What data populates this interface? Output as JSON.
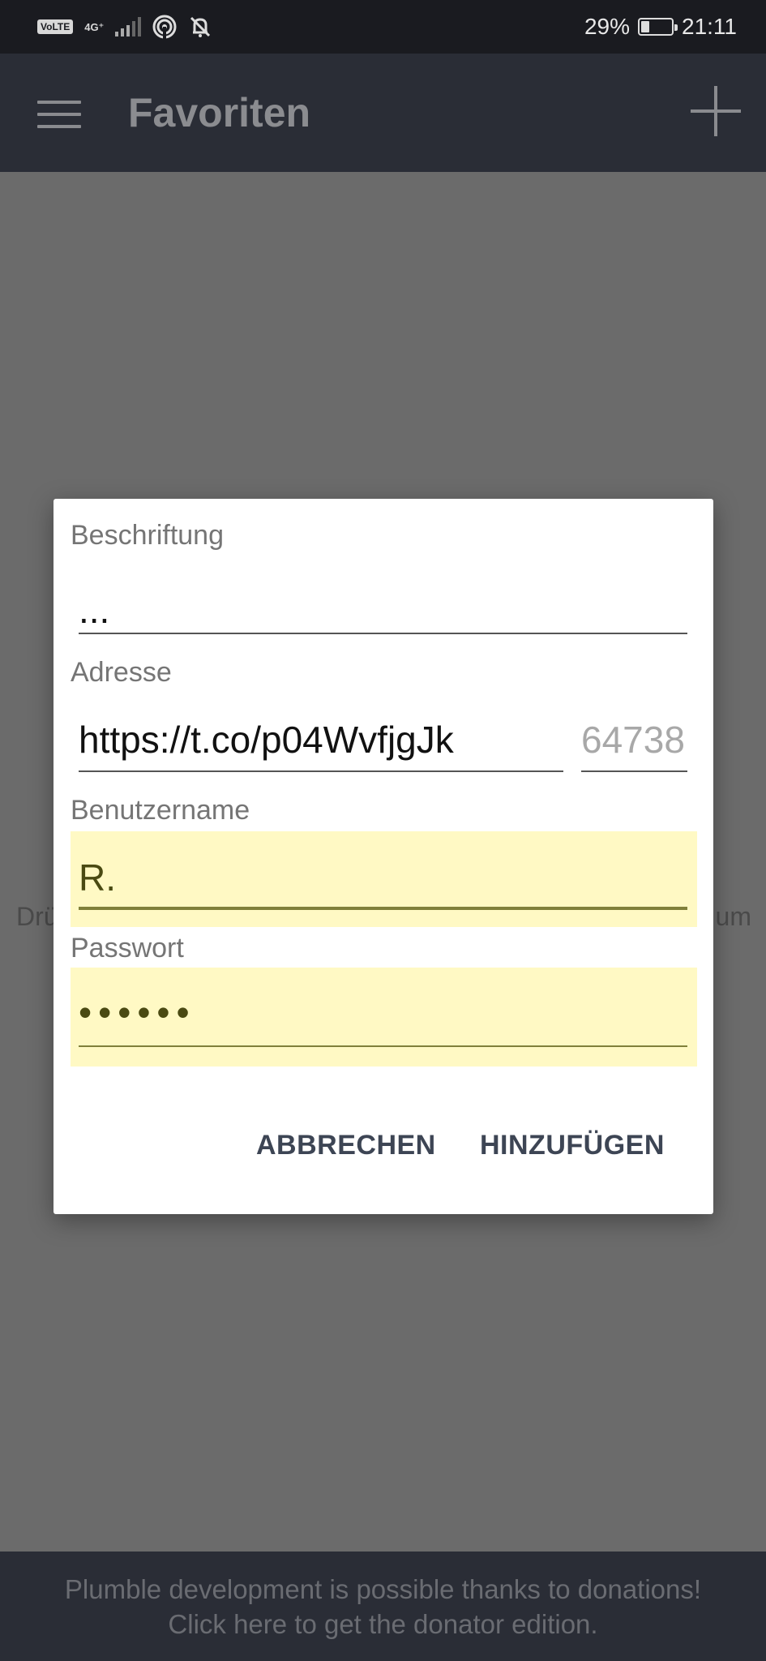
{
  "status_bar": {
    "volte": "VoLTE",
    "network": "4G⁺",
    "battery_percent": "29%",
    "battery_level": 0.29,
    "time": "21:11"
  },
  "app_bar": {
    "title": "Favoriten",
    "menu_icon": "hamburger-menu-icon",
    "add_icon": "plus-icon"
  },
  "background_hint": {
    "left_fragment": "Drü",
    "right_fragment": "um"
  },
  "dialog": {
    "label_field": {
      "label": "Beschriftung",
      "value": "..."
    },
    "address_field": {
      "label": "Adresse",
      "value": "https://t.co/p04WvfjgJk"
    },
    "port_field": {
      "placeholder": "64738"
    },
    "username_field": {
      "label": "Benutzername",
      "value": "R."
    },
    "password_field": {
      "label": "Passwort",
      "value": "••••••"
    },
    "cancel_label": "ABBRECHEN",
    "add_label": "HINZUFÜGEN",
    "autofill_color": "#fff9c4"
  },
  "donate_banner": {
    "line1": "Plumble development is possible thanks to donations!",
    "line2": "Click here to get the donator edition."
  }
}
